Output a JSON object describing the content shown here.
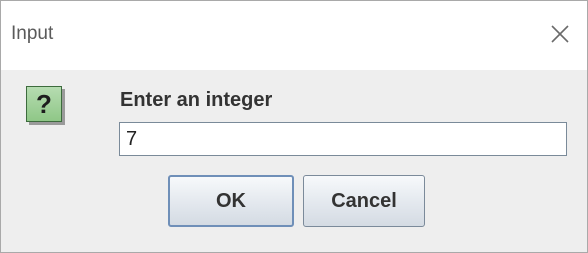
{
  "dialog": {
    "title": "Input",
    "close_icon": "close-icon",
    "question_icon": "question-icon",
    "question_glyph": "?",
    "prompt": "Enter an integer",
    "input_value": "7",
    "ok_label": "OK",
    "cancel_label": "Cancel"
  },
  "colors": {
    "icon_green": "#9fd197",
    "button_focus_border": "#6f8fb8",
    "background": "#eeeeee"
  }
}
